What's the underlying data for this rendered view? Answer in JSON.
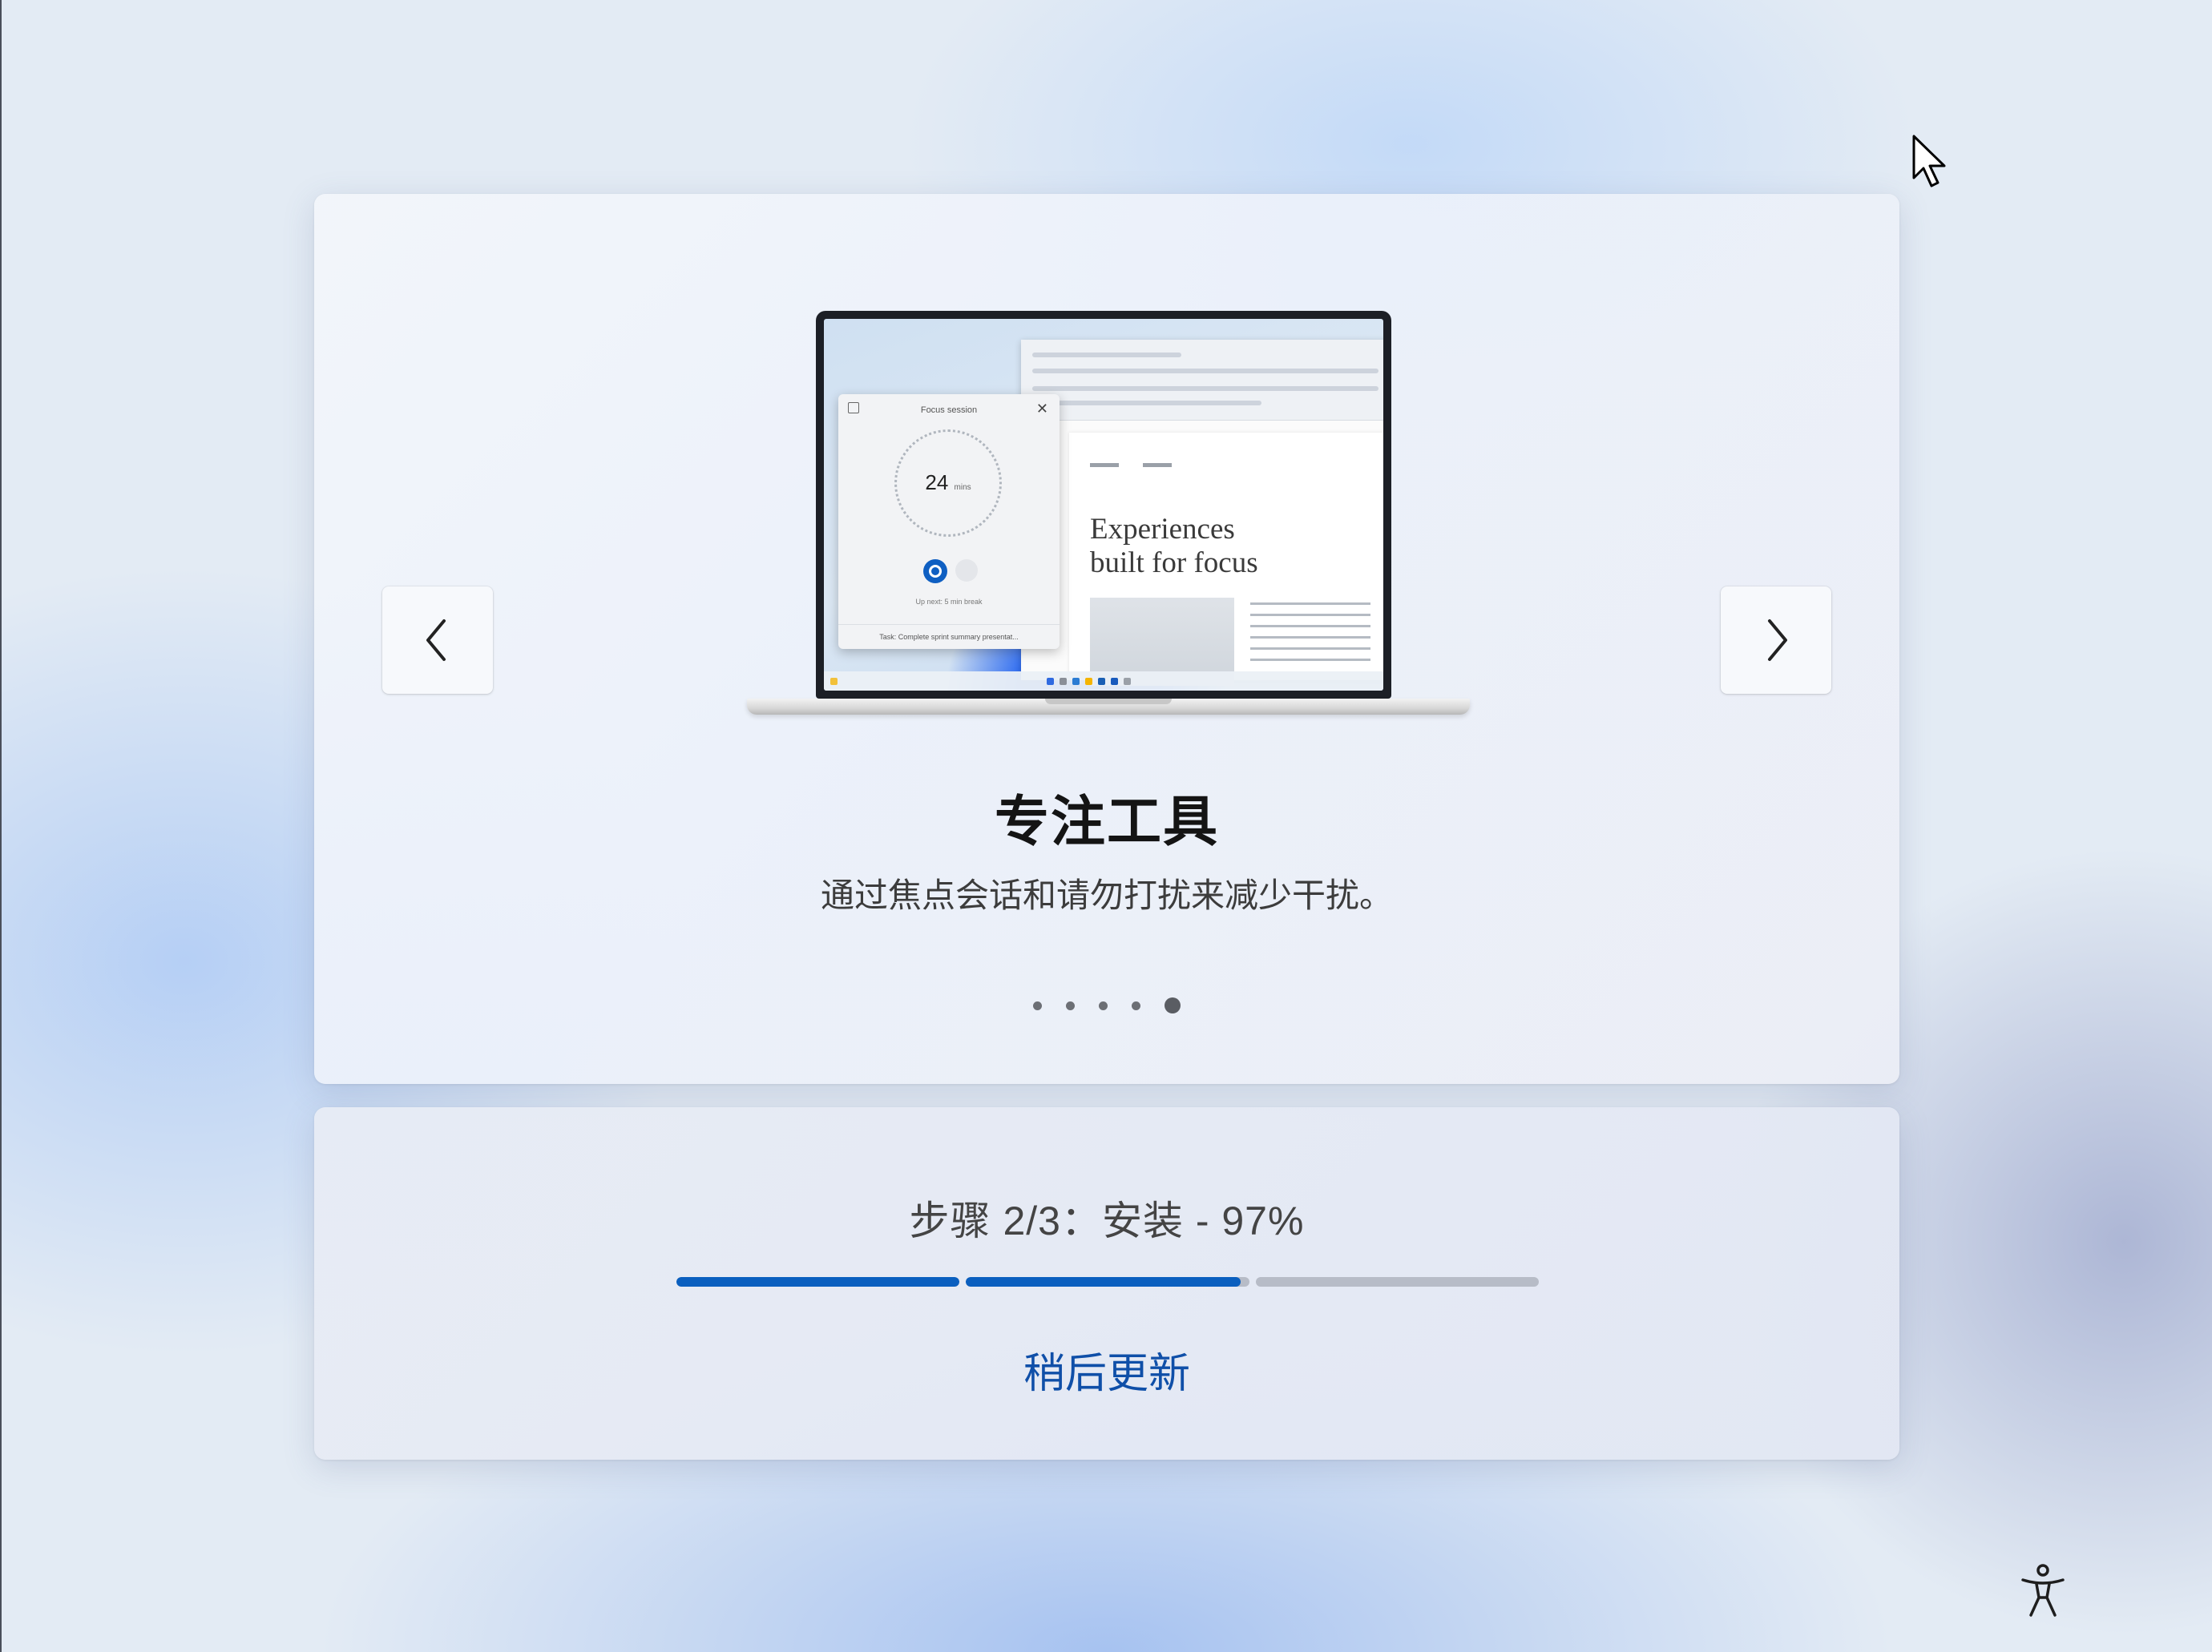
{
  "carousel": {
    "title": "专注工具",
    "description": "通过焦点会话和请勿打扰来减少干扰。",
    "dots": [
      false,
      false,
      false,
      false,
      true
    ],
    "prev_icon": "chevron-left-icon",
    "next_icon": "chevron-right-icon",
    "illustration": {
      "word_heading_line1": "Experiences",
      "word_heading_line2": "built for focus",
      "focus_title": "Focus session",
      "focus_minutes": "24",
      "focus_minutes_unit": "mins",
      "focus_note": "Up next: 5 min break",
      "focus_task": "Task: Complete sprint summary presentat..."
    }
  },
  "progress": {
    "status": "步骤 2/3：安装 - 97%",
    "step_current": 2,
    "step_total": 3,
    "percent": 97,
    "segments": [
      1.0,
      0.97,
      0.0
    ],
    "update_later_label": "稍后更新"
  },
  "colors": {
    "accent": "#0a5fbf",
    "link": "#0f4fa8",
    "track": "#b7bcc7"
  },
  "icons": {
    "cursor": "mouse-pointer-icon",
    "accessibility": "accessibility-icon"
  }
}
